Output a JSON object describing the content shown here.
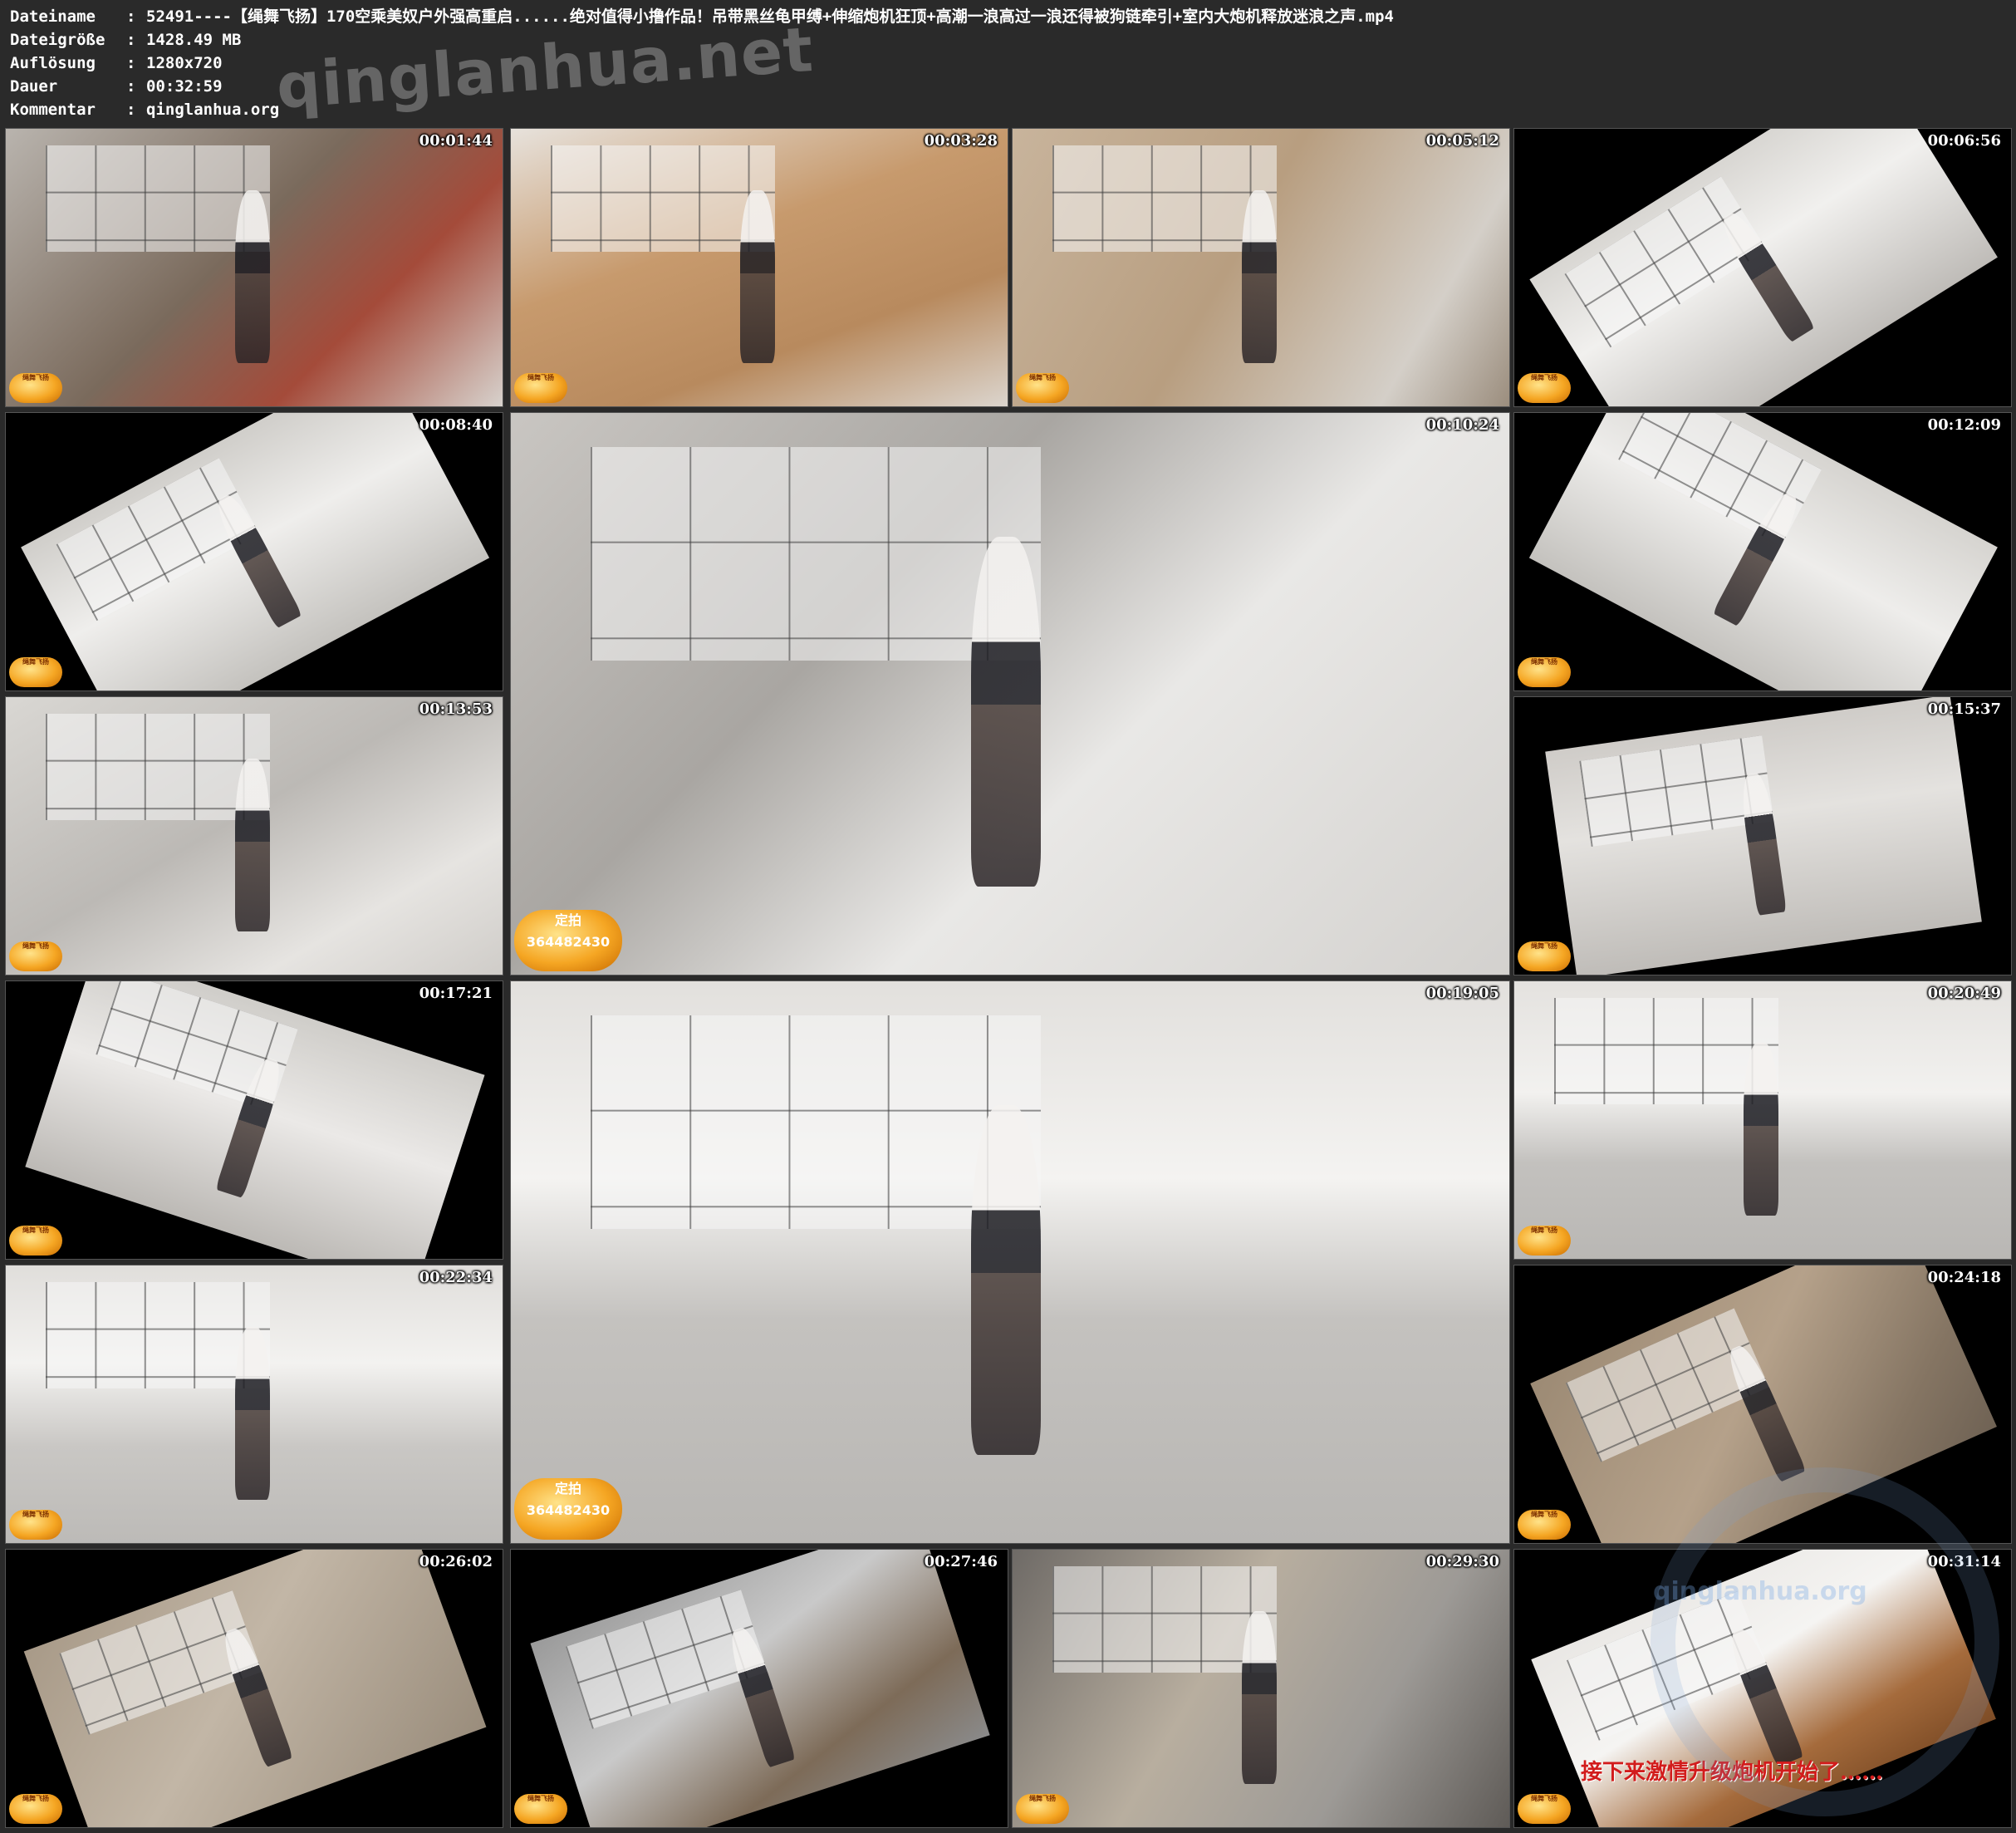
{
  "header": {
    "rows": [
      {
        "key": "Dateiname",
        "value": "52491----【绳舞飞扬】170空乘美奴户外强高重启......绝对值得小撸作品！吊带黑丝龟甲缚+伸缩炮机狂顶+高潮一浪高过一浪还得被狗链牵引+室内大炮机释放迷浪之声.mp4"
      },
      {
        "key": "Dateigröße",
        "value": "1428.49 MB"
      },
      {
        "key": "Auflösung",
        "value": "1280x720"
      },
      {
        "key": "Dauer",
        "value": "00:32:59"
      },
      {
        "key": "Kommentar",
        "value": "qinglanhua.org"
      }
    ],
    "separator": ":",
    "watermark": "qinglanhua.net"
  },
  "thumbnails": [
    {
      "timestamp": "00:01:44",
      "logo": "绳舞飞扬"
    },
    {
      "timestamp": "00:03:28",
      "logo": "绳舞飞扬"
    },
    {
      "timestamp": "00:05:12",
      "logo": "绳舞飞扬"
    },
    {
      "timestamp": "00:06:56",
      "logo": "绳舞飞扬"
    },
    {
      "timestamp": "00:08:40",
      "logo": "绳舞飞扬"
    },
    {
      "timestamp": "00:10:24",
      "logo": "定拍364482430"
    },
    {
      "timestamp": "00:12:09",
      "logo": "绳舞飞扬"
    },
    {
      "timestamp": "00:13:53",
      "logo": "绳舞飞扬"
    },
    {
      "timestamp": "00:15:37",
      "logo": "绳舞飞扬"
    },
    {
      "timestamp": "00:17:21",
      "logo": "绳舞飞扬"
    },
    {
      "timestamp": "00:19:05",
      "logo": "定拍364482430"
    },
    {
      "timestamp": "00:20:49",
      "logo": "绳舞飞扬"
    },
    {
      "timestamp": "00:22:34",
      "logo": "绳舞飞扬"
    },
    {
      "timestamp": "00:24:18",
      "logo": "绳舞飞扬"
    },
    {
      "timestamp": "00:26:02",
      "logo": "绳舞飞扬"
    },
    {
      "timestamp": "00:27:46",
      "logo": "绳舞飞扬"
    },
    {
      "timestamp": "00:29:30",
      "logo": "绳舞飞扬"
    },
    {
      "timestamp": "00:31:14",
      "logo": "绳舞飞扬"
    }
  ],
  "caption": "接下来激情升级炮机开始了……",
  "corner_watermark": "qinglanhua.org"
}
